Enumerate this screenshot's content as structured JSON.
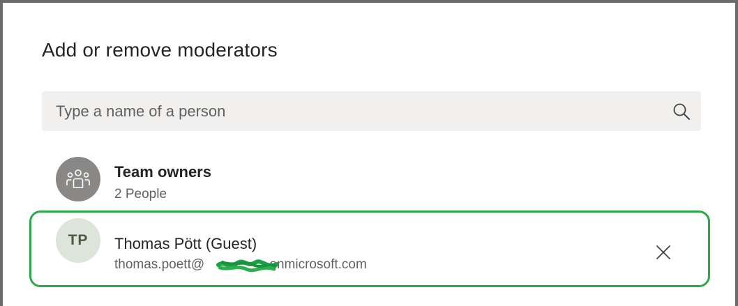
{
  "dialog": {
    "title": "Add or remove moderators"
  },
  "search": {
    "placeholder": "Type a name of a person",
    "icon": "search-icon"
  },
  "moderators": [
    {
      "name": "Team owners",
      "subtitle": "2 People",
      "avatar_icon": "people-group-icon",
      "avatar_color": "#8a8886"
    },
    {
      "name": "Thomas Pött (Guest)",
      "initials": "TP",
      "email_prefix": "thomas.poett@",
      "email_suffix": ".onmicrosoft.com",
      "avatar_color": "#dde4da",
      "remove_icon": "close-icon"
    }
  ],
  "colors": {
    "highlight": "#2aa84a",
    "redaction": "#1f9e45",
    "search_bg": "#f1f0ef"
  }
}
